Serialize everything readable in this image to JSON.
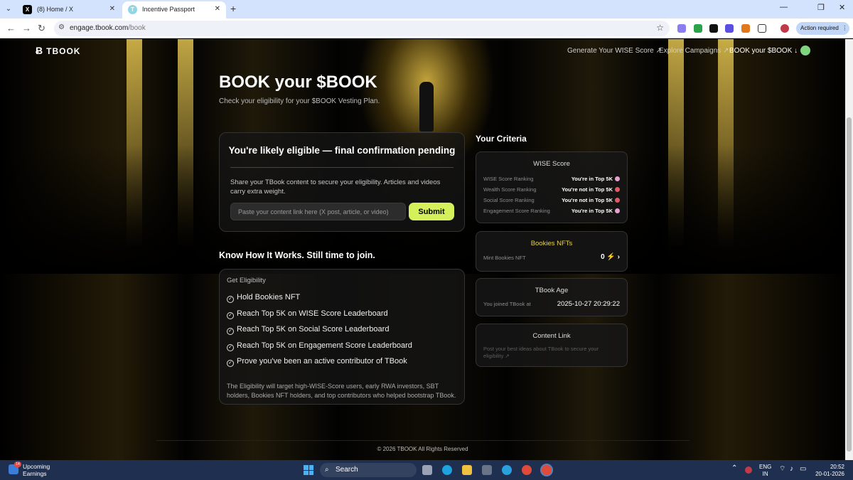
{
  "browser": {
    "tabs": [
      {
        "title": "(8) Home / X",
        "active": false
      },
      {
        "title": "Incentive Passport",
        "active": true
      }
    ],
    "url_host": "engage.tbook.com",
    "url_path": "/book",
    "action_required": "Action required"
  },
  "nav": {
    "brand": "TBOOK",
    "links": [
      "Generate Your WISE Score ↗",
      "Explore Campaigns ↗",
      "BOOK your $BOOK ↓"
    ]
  },
  "hero": {
    "title": "BOOK your $BOOK",
    "subtitle": "Check your eligibility for your $BOOK Vesting Plan."
  },
  "eligibility": {
    "heading": "You're likely eligible — final confirmation pending",
    "description": "Share your TBook content to secure your eligibility. Articles and videos carry extra weight.",
    "input_placeholder": "Paste your content link here (X post, article, or video)",
    "submit_label": "Submit"
  },
  "how": {
    "title": "Know How It Works. Still time to join.",
    "label": "Get Eligibility",
    "items": [
      "Hold Bookies NFT",
      "Reach Top 5K on WISE Score Leaderboard",
      "Reach Top 5K on Social Score Leaderboard",
      "Reach Top 5K on Engagement Score Leaderboard",
      "Prove you've been an active contributor of TBook"
    ],
    "note": "The Eligibility will target high-WISE-Score users, early RWA investors, SBT holders, Bookies NFT holders, and top contributors who helped bootstrap TBook."
  },
  "criteria": {
    "title": "Your Criteria",
    "wise": {
      "title": "WISE Score",
      "rows": [
        {
          "label": "WISE Score Ranking",
          "value": "You're in Top 5K",
          "status": "in",
          "color": "#e8a0d0"
        },
        {
          "label": "Wealth Score Ranking",
          "value": "You're not in Top 5K",
          "status": "out",
          "color": "#e05a6a"
        },
        {
          "label": "Social Score Ranking",
          "value": "You're not in Top 5K",
          "status": "out",
          "color": "#e05a6a"
        },
        {
          "label": "Engagement Score Ranking",
          "value": "You're in Top 5K",
          "status": "in",
          "color": "#e8a0d0"
        }
      ]
    },
    "bookies": {
      "title": "Bookies NFTs",
      "label": "Mint Bookies NFT",
      "value": "0"
    },
    "age": {
      "title": "TBook Age",
      "label": "You joined TBook at",
      "value": "2025-10-27 20:29:22"
    },
    "content": {
      "title": "Content Link",
      "hint": "Post your best ideas about TBook to secure your eligibility ↗"
    }
  },
  "footer": {
    "text": "© 2026 TBOOK All Rights Reserved"
  },
  "taskbar": {
    "news_title": "Upcoming",
    "news_sub": "Earnings",
    "news_badge": "14",
    "search": "Search",
    "lang": "ENG",
    "region": "IN",
    "time": "20:52",
    "date": "20-01-2026"
  },
  "colors": {
    "accent": "#d4f05a",
    "bookies_title": "#e6d24a"
  }
}
